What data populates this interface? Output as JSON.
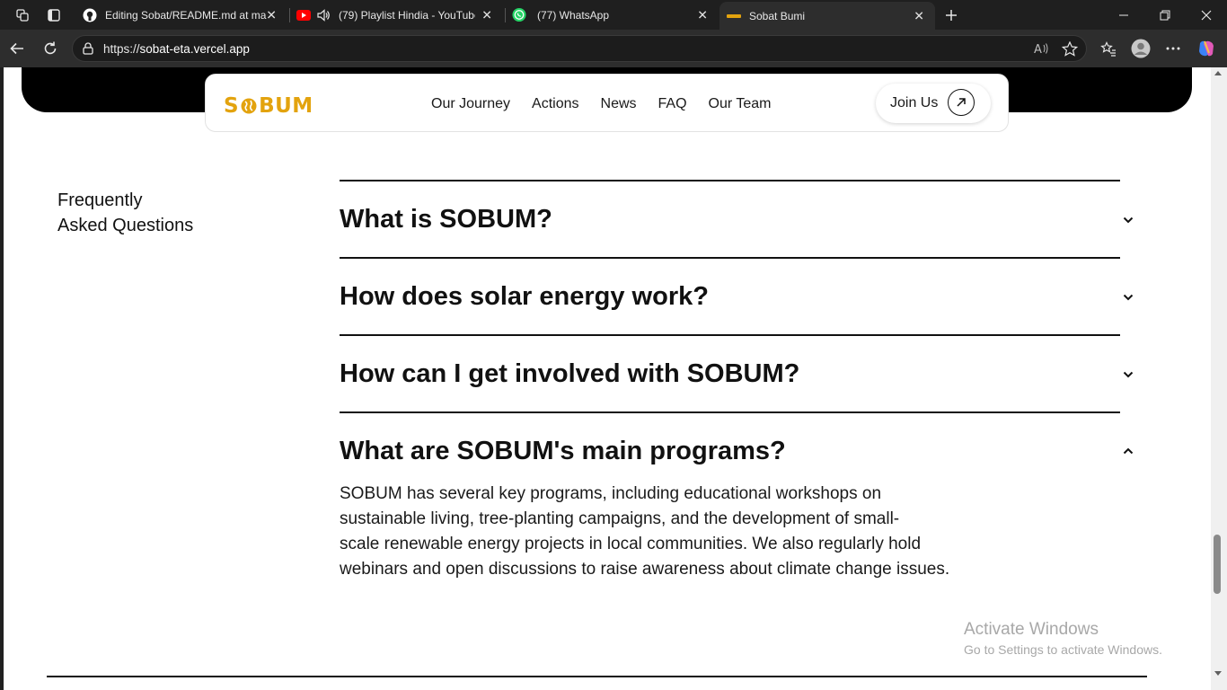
{
  "browser": {
    "tabs": [
      {
        "title": "Editing Sobat/README.md at ma",
        "icon": "github-icon"
      },
      {
        "title": "(79) Playlist Hindia - YouTube",
        "icon": "youtube-icon"
      },
      {
        "title": "(77) WhatsApp",
        "icon": "whatsapp-icon"
      },
      {
        "title": "Sobat Bumi",
        "icon": "sobum-favicon",
        "active": true
      }
    ],
    "url": {
      "scheme": "https://",
      "host": "sobat-eta.vercel.app"
    }
  },
  "site": {
    "logo_text": "S  BUM",
    "brand_color": "#e3a30e",
    "nav": [
      "Our Journey",
      "Actions",
      "News",
      "FAQ",
      "Our Team"
    ],
    "join_label": "Join Us"
  },
  "faq": {
    "heading_line1": "Frequently",
    "heading_line2": "Asked Questions",
    "items": [
      {
        "question": "What is SOBUM?",
        "expanded": false
      },
      {
        "question": "How does solar energy work?",
        "expanded": false
      },
      {
        "question": "How can I get involved with SOBUM?",
        "expanded": false
      },
      {
        "question": "What are SOBUM's main programs?",
        "expanded": true,
        "answer_lines": [
          "SOBUM has several key programs, including educational workshops on",
          "sustainable living, tree-planting campaigns, and the development of small-",
          "scale renewable energy projects in local communities. We also regularly hold",
          "webinars and open discussions to raise awareness about climate change issues."
        ]
      }
    ]
  },
  "watermark": {
    "line1": "Activate Windows",
    "line2": "Go to Settings to activate Windows."
  }
}
